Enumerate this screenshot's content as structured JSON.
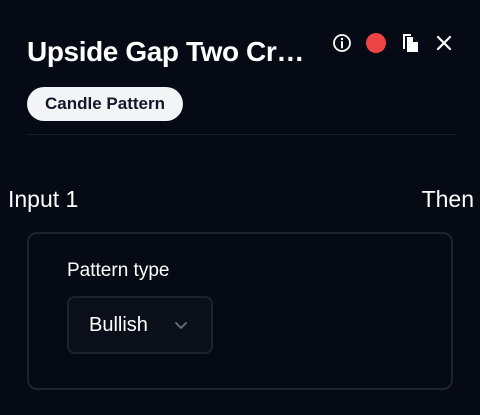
{
  "header": {
    "title": "Upside Gap Two Cr…",
    "status_color": "#ef4444",
    "icons": [
      "info-icon",
      "status-dot",
      "copy-icon",
      "close-icon"
    ]
  },
  "badge": {
    "label": "Candle Pattern"
  },
  "flow": {
    "input_label": "Input 1",
    "then_label": "Then"
  },
  "config": {
    "pattern_type_label": "Pattern type",
    "pattern_type_value": "Bullish"
  }
}
